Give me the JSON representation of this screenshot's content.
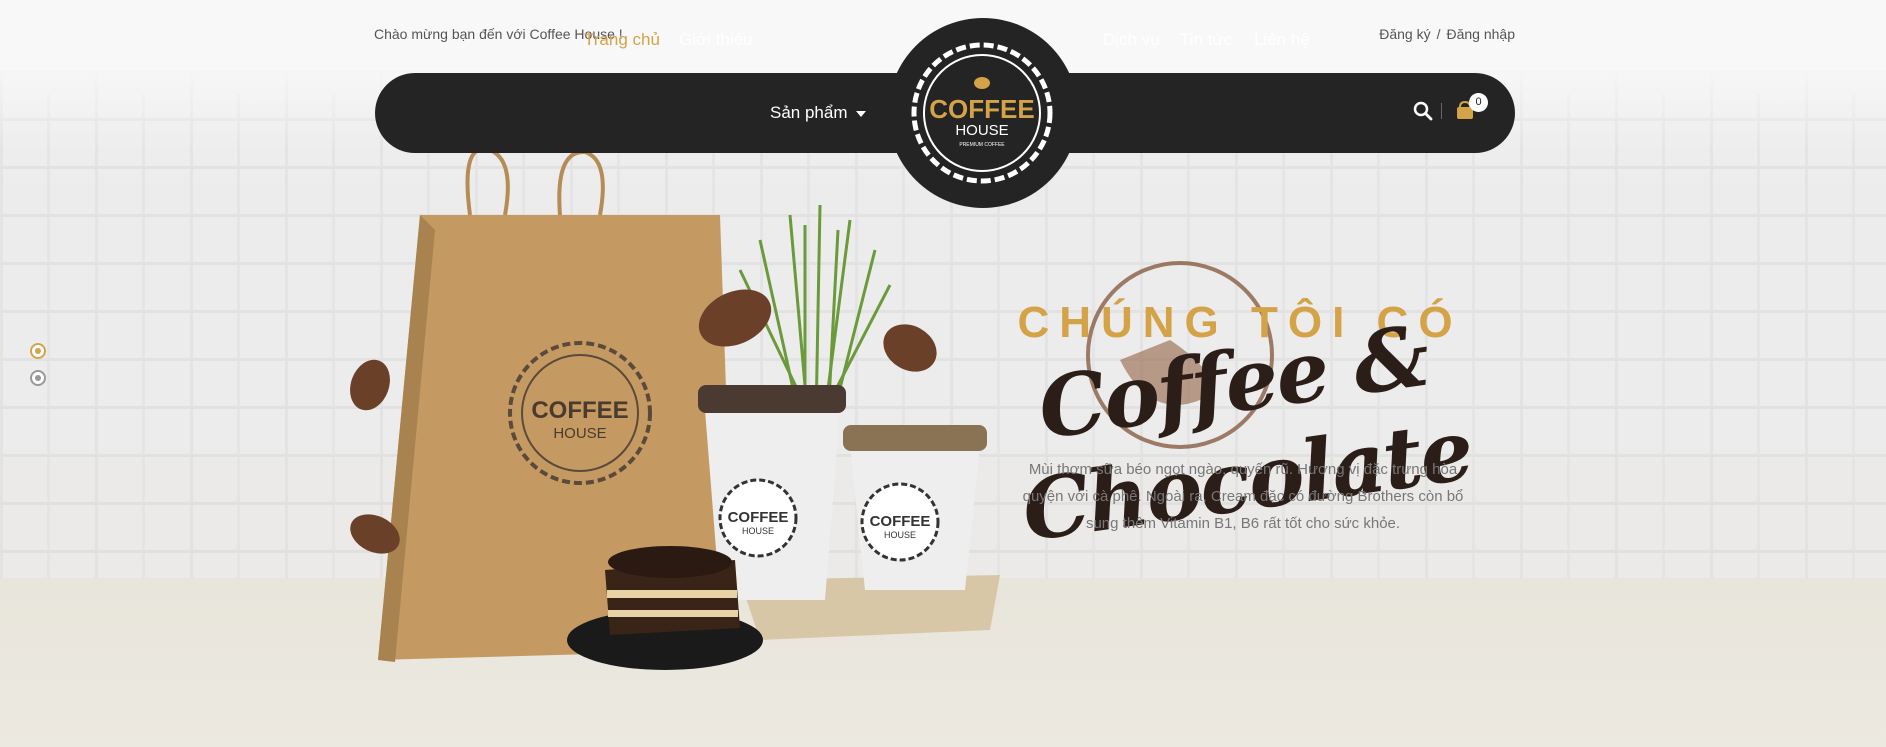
{
  "topbar": {
    "welcome": "Chào mừng bạn đến với Coffee House !",
    "register": "Đăng ký",
    "separator": "/",
    "login": "Đăng nhập"
  },
  "nav": {
    "items": [
      {
        "label": "Trang chủ",
        "active": true
      },
      {
        "label": "Giới thiệu"
      },
      {
        "label": "Sản phẩm",
        "has_dropdown": true
      },
      {
        "label": "Dịch vụ"
      },
      {
        "label": "Tin tức"
      },
      {
        "label": "Liên hệ"
      }
    ],
    "cart_count": "0"
  },
  "logo": {
    "line1": "COFFEE",
    "line2": "HOUSE",
    "tagline": "PREMIUM COFFEE"
  },
  "hero": {
    "kicker": "CHÚNG TÔI CÓ",
    "title": "Coffee & Chocolate",
    "description": "Mùi thơm sữa béo ngọt ngào, quyến rũ. Hương vị đặc trưng hòa quyện với cà phê. Ngoài ra, Cream đặc có đường Brothers còn bổ sung thêm Vitamin B1, B6 rất tốt cho sức khỏe."
  },
  "slider": {
    "slides": 2,
    "active": 1
  },
  "colors": {
    "accent": "#d4a347",
    "nav_bg": "#242424",
    "bag": "#c49a62",
    "title": "#2b1d17"
  },
  "icons": [
    "search-icon",
    "cart-icon",
    "caret-down-icon",
    "coffee-bean-icon"
  ]
}
